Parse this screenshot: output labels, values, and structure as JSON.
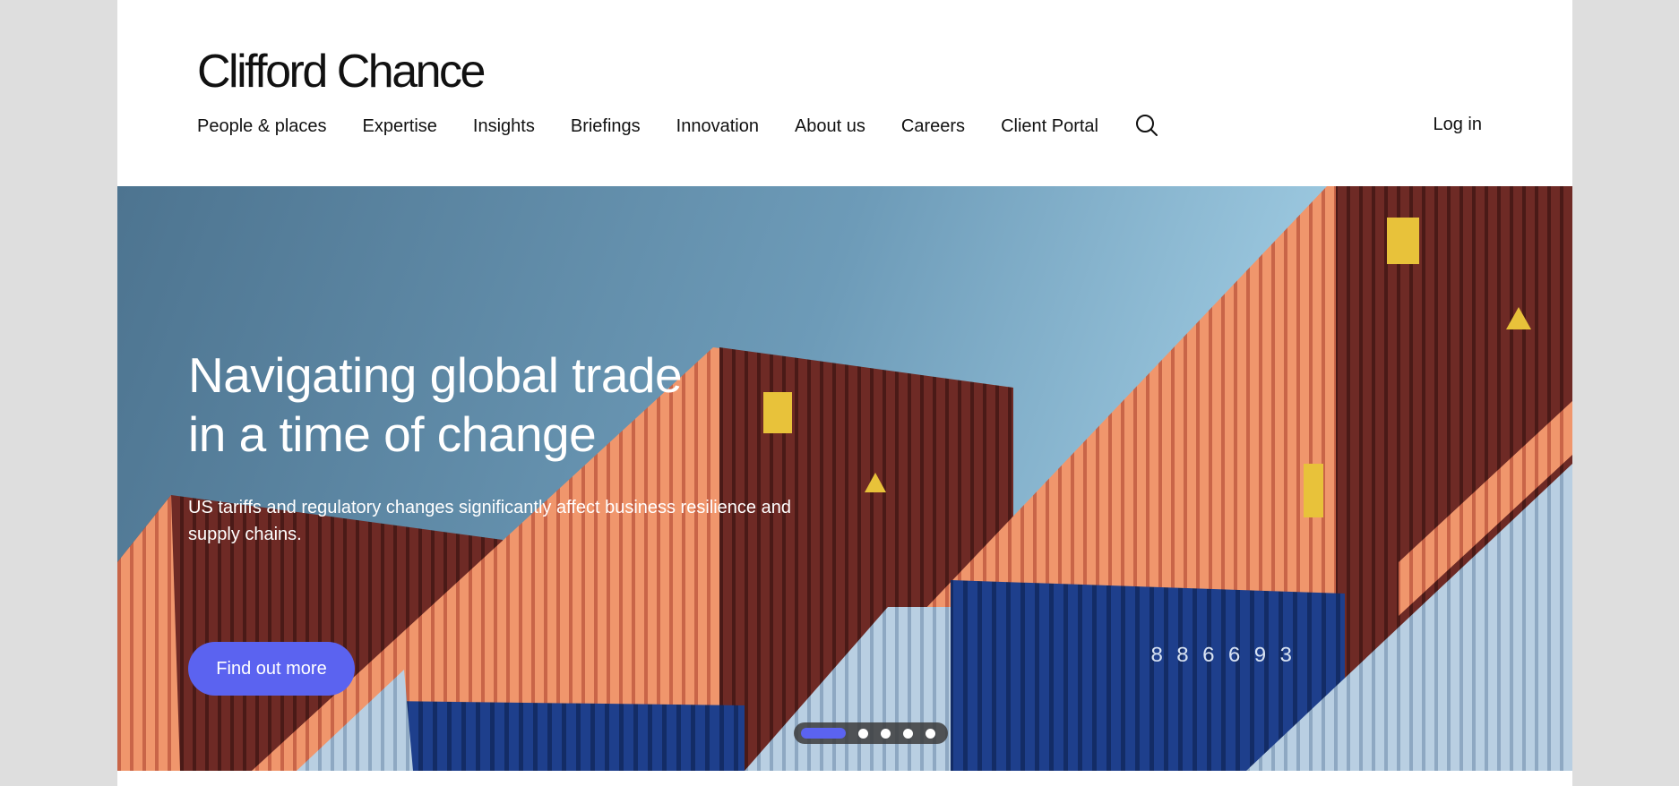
{
  "brand": {
    "name": "Clifford Chance"
  },
  "nav": {
    "items": [
      "People & places",
      "Expertise",
      "Insights",
      "Briefings",
      "Innovation",
      "About us",
      "Careers",
      "Client Portal"
    ],
    "login_label": "Log in"
  },
  "hero": {
    "title": "Navigating global trade in a time of change",
    "subtitle": "US tariffs and regulatory changes significantly affect business resilience and supply chains.",
    "cta_label": "Find out more",
    "carousel": {
      "slides": 5,
      "active": 1
    }
  },
  "colors": {
    "accent": "#5b63f0",
    "text": "#111111",
    "page_bg": "#dedede"
  },
  "icons": {
    "search": "search-icon"
  }
}
